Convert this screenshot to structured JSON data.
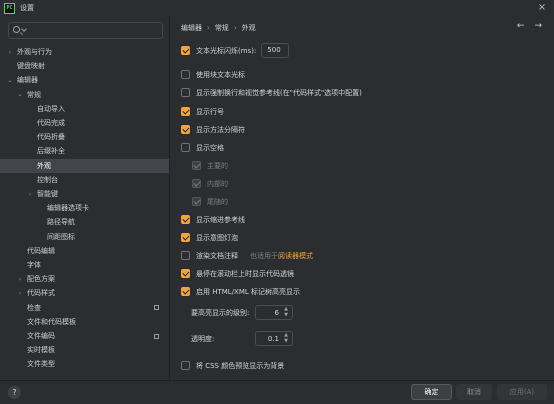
{
  "window": {
    "title": "设置",
    "app_icon_text": "PC"
  },
  "search": {
    "placeholder": "",
    "value": ""
  },
  "tree": {
    "items": [
      {
        "label": "外观与行为",
        "arrow": "›",
        "indent": 0
      },
      {
        "label": "键盘映射",
        "arrow": "",
        "indent": 0
      },
      {
        "label": "编辑器",
        "arrow": "⌄",
        "indent": 0
      },
      {
        "label": "常规",
        "arrow": "⌄",
        "indent": 1
      },
      {
        "label": "自动导入",
        "arrow": "",
        "indent": 2
      },
      {
        "label": "代码完成",
        "arrow": "",
        "indent": 2
      },
      {
        "label": "代码折叠",
        "arrow": "",
        "indent": 2
      },
      {
        "label": "后缀补全",
        "arrow": "",
        "indent": 2
      },
      {
        "label": "外观",
        "arrow": "",
        "indent": 2,
        "selected": true
      },
      {
        "label": "控制台",
        "arrow": "",
        "indent": 2
      },
      {
        "label": "智能键",
        "arrow": "›",
        "indent": 2
      },
      {
        "label": "编辑器选项卡",
        "arrow": "",
        "indent": 3
      },
      {
        "label": "路径导航",
        "arrow": "",
        "indent": 3
      },
      {
        "label": "间距图标",
        "arrow": "",
        "indent": 3
      },
      {
        "label": "代码编辑",
        "arrow": "",
        "indent": 1
      },
      {
        "label": "字体",
        "arrow": "",
        "indent": 1
      },
      {
        "label": "配色方案",
        "arrow": "›",
        "indent": 1
      },
      {
        "label": "代码样式",
        "arrow": "›",
        "indent": 1
      },
      {
        "label": "检查",
        "arrow": "",
        "indent": 1,
        "badge": true
      },
      {
        "label": "文件和代码模板",
        "arrow": "",
        "indent": 1
      },
      {
        "label": "文件编码",
        "arrow": "",
        "indent": 1,
        "badge": true
      },
      {
        "label": "实时模板",
        "arrow": "",
        "indent": 1
      },
      {
        "label": "文件类型",
        "arrow": "",
        "indent": 1
      }
    ]
  },
  "breadcrumb": {
    "items": [
      "编辑器",
      "常规",
      "外观"
    ],
    "separator": "›"
  },
  "nav": {
    "back": "←",
    "forward": "→"
  },
  "options": {
    "caret_blink": {
      "label": "文本光标闪烁(ms):",
      "checked": true,
      "value": "500"
    },
    "block_caret": {
      "label": "使用块文本光标",
      "checked": false
    },
    "hard_wrap_guides": {
      "label": "显示强制换行和视觉参考线(在\"代码样式\"选项中配置)",
      "checked": false
    },
    "line_numbers": {
      "label": "显示行号",
      "checked": true
    },
    "method_separators": {
      "label": "显示方法分隔符",
      "checked": true
    },
    "whitespaces": {
      "label": "显示空格",
      "checked": false
    },
    "ws_leading": {
      "label": "主要的",
      "checked": true,
      "disabled": true
    },
    "ws_inner": {
      "label": "内部的",
      "checked": true,
      "disabled": true
    },
    "ws_trailing": {
      "label": "尾随的",
      "checked": true,
      "disabled": true
    },
    "indent_guides": {
      "label": "显示缩进参考线",
      "checked": true
    },
    "intention_bulb": {
      "label": "显示意图灯泡",
      "checked": true
    },
    "render_docs": {
      "label": "渲染文档注释",
      "checked": false,
      "hint_prefix": "也适用于",
      "hint_link": "阅读器模式"
    },
    "code_lens_scrollbar": {
      "label": "悬停在滚动栏上时显示代码透镜",
      "checked": true
    },
    "html_xml_highlight": {
      "label": "启用 HTML/XML 标记树高亮显示",
      "checked": true
    },
    "highlight_levels": {
      "label": "要高亮显示的级别:",
      "value": "6"
    },
    "opacity": {
      "label": "透明度:",
      "value": "0.1"
    },
    "css_color_bg": {
      "label": "将 CSS 颜色预览显示为背景",
      "checked": false
    }
  },
  "footer": {
    "help": "?",
    "ok": "确定",
    "cancel": "取消",
    "apply": "应用(A)"
  },
  "colors": {
    "accent": "#f2a53c",
    "background": "#2b2d30",
    "selection": "#43454a"
  }
}
